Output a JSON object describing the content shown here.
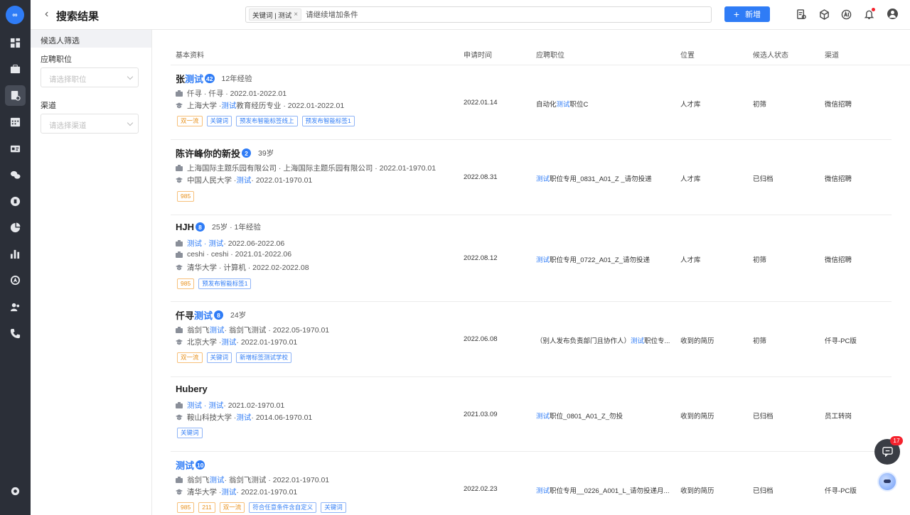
{
  "app": {
    "logo_text": "∞"
  },
  "header": {
    "title": "搜索结果",
    "search_chip": "关键词 | 测试",
    "search_placeholder": "请继续增加条件",
    "new_button": "新增"
  },
  "filter": {
    "heading": "候选人筛选",
    "job_label": "应聘职位",
    "job_placeholder": "请选择职位",
    "channel_label": "渠道",
    "channel_placeholder": "请选择渠道"
  },
  "table": {
    "headers": [
      "基本资料",
      "申请时间",
      "应聘职位",
      "位置",
      "候选人状态",
      "渠道"
    ]
  },
  "candidates": [
    {
      "name_plain": "张",
      "name_hl": "测试",
      "badge": "42",
      "meta": "12年经验",
      "line1": {
        "pre": "",
        "hl": "",
        "post": "仟寻 · 仟寻 · 2022.01-2022.01"
      },
      "line2": {
        "pre": "上海大学 · ",
        "hl": "测试",
        "post": "教育经历专业 · 2022.01-2022.01"
      },
      "tags": [
        "双一流",
        "关键词",
        "预发布智能标签线上",
        "预发布智能标签1"
      ],
      "date": "2022.01.14",
      "job": {
        "pre": "自动化",
        "hl": "测试",
        "post": "职位C"
      },
      "location": "人才库",
      "status": "初筛",
      "channel": "微信招聘"
    },
    {
      "name_plain": "陈许峰你的新投",
      "name_hl": "",
      "badge": "2",
      "meta": "39岁",
      "line1": {
        "pre": "",
        "hl": "",
        "post": "上海国际主题乐园有限公司 · 上海国际主题乐园有限公司 · 2022.01-1970.01"
      },
      "line2": {
        "pre": "中国人民大学 · ",
        "hl": "测试",
        "post": " · 2022.01-1970.01"
      },
      "tags": [
        "985"
      ],
      "date": "2022.08.31",
      "job": {
        "pre": "",
        "hl": "测试",
        "post": "职位专用_0831_A01_Z _请勿投递"
      },
      "location": "人才库",
      "status": "已归档",
      "channel": "微信招聘"
    },
    {
      "name_plain": "HJH",
      "name_hl": "",
      "badge": "8",
      "meta": "25岁 · 1年经验",
      "line1": {
        "pre": "",
        "hl": "测试 · 测试",
        "post": " · 2022.06-2022.06"
      },
      "line2": {
        "pre": "ceshi · ceshi · 2021.01-2022.06",
        "hl": "",
        "post": ""
      },
      "line3": {
        "pre": "清华大学 · 计算机 · 2022.02-2022.08",
        "hl": "",
        "post": ""
      },
      "tags": [
        "985",
        "预发布智能标签1"
      ],
      "date": "2022.08.12",
      "job": {
        "pre": "",
        "hl": "测试",
        "post": "职位专用_0722_A01_Z_请勿投递"
      },
      "location": "人才库",
      "status": "初筛",
      "channel": "微信招聘"
    },
    {
      "name_plain": "仟寻",
      "name_hl": "测试",
      "badge": "8",
      "meta": "24岁",
      "line1": {
        "pre": "翁剑飞",
        "hl": "测试",
        "post": " · 翁剑飞测试 · 2022.05-1970.01"
      },
      "line2": {
        "pre": "北京大学 · ",
        "hl": "测试",
        "post": " · 2022.01-1970.01"
      },
      "tags": [
        "双一流",
        "关键词",
        "新增标签测试学校"
      ],
      "date": "2022.06.08",
      "job": {
        "pre": "（别人发布负责部门且协作人）",
        "hl": "测试",
        "post": "职位专..."
      },
      "location": "收到的简历",
      "status": "初筛",
      "channel": "仟寻-PC版"
    },
    {
      "name_plain": "Hubery",
      "name_hl": "",
      "badge": "",
      "meta": "",
      "line1": {
        "pre": "",
        "hl": "测试 · 测试",
        "post": " · 2021.02-1970.01"
      },
      "line2": {
        "pre": "鞍山科技大学 · ",
        "hl": "测试",
        "post": " · 2014.06-1970.01"
      },
      "tags": [
        "关键词"
      ],
      "date": "2021.03.09",
      "job": {
        "pre": "",
        "hl": "测试",
        "post": "职位_0801_A01_Z_勿投"
      },
      "location": "收到的简历",
      "status": "已归档",
      "channel": "员工转岗"
    },
    {
      "name_plain": "",
      "name_hl": "测试",
      "badge": "10",
      "meta": "",
      "line1": {
        "pre": "翁剑飞",
        "hl": "测试",
        "post": " · 翁剑飞测试 · 2022.01-1970.01"
      },
      "line2": {
        "pre": "清华大学 · ",
        "hl": "测试",
        "post": " · 2022.01-1970.01"
      },
      "tags": [
        "985",
        "211",
        "双一流",
        "符合任意条件含自定义",
        "关键词"
      ],
      "date": "2022.02.23",
      "job": {
        "pre": "",
        "hl": "测试",
        "post": "职位专用__0226_A001_L_请勿投递月..."
      },
      "location": "收到的简历",
      "status": "已归档",
      "channel": "仟寻-PC版"
    }
  ],
  "chat": {
    "unread": "17"
  },
  "colors": {
    "accent": "#2f7cf6",
    "rail": "#2b2f38",
    "tag_orange": "#e8901a"
  }
}
